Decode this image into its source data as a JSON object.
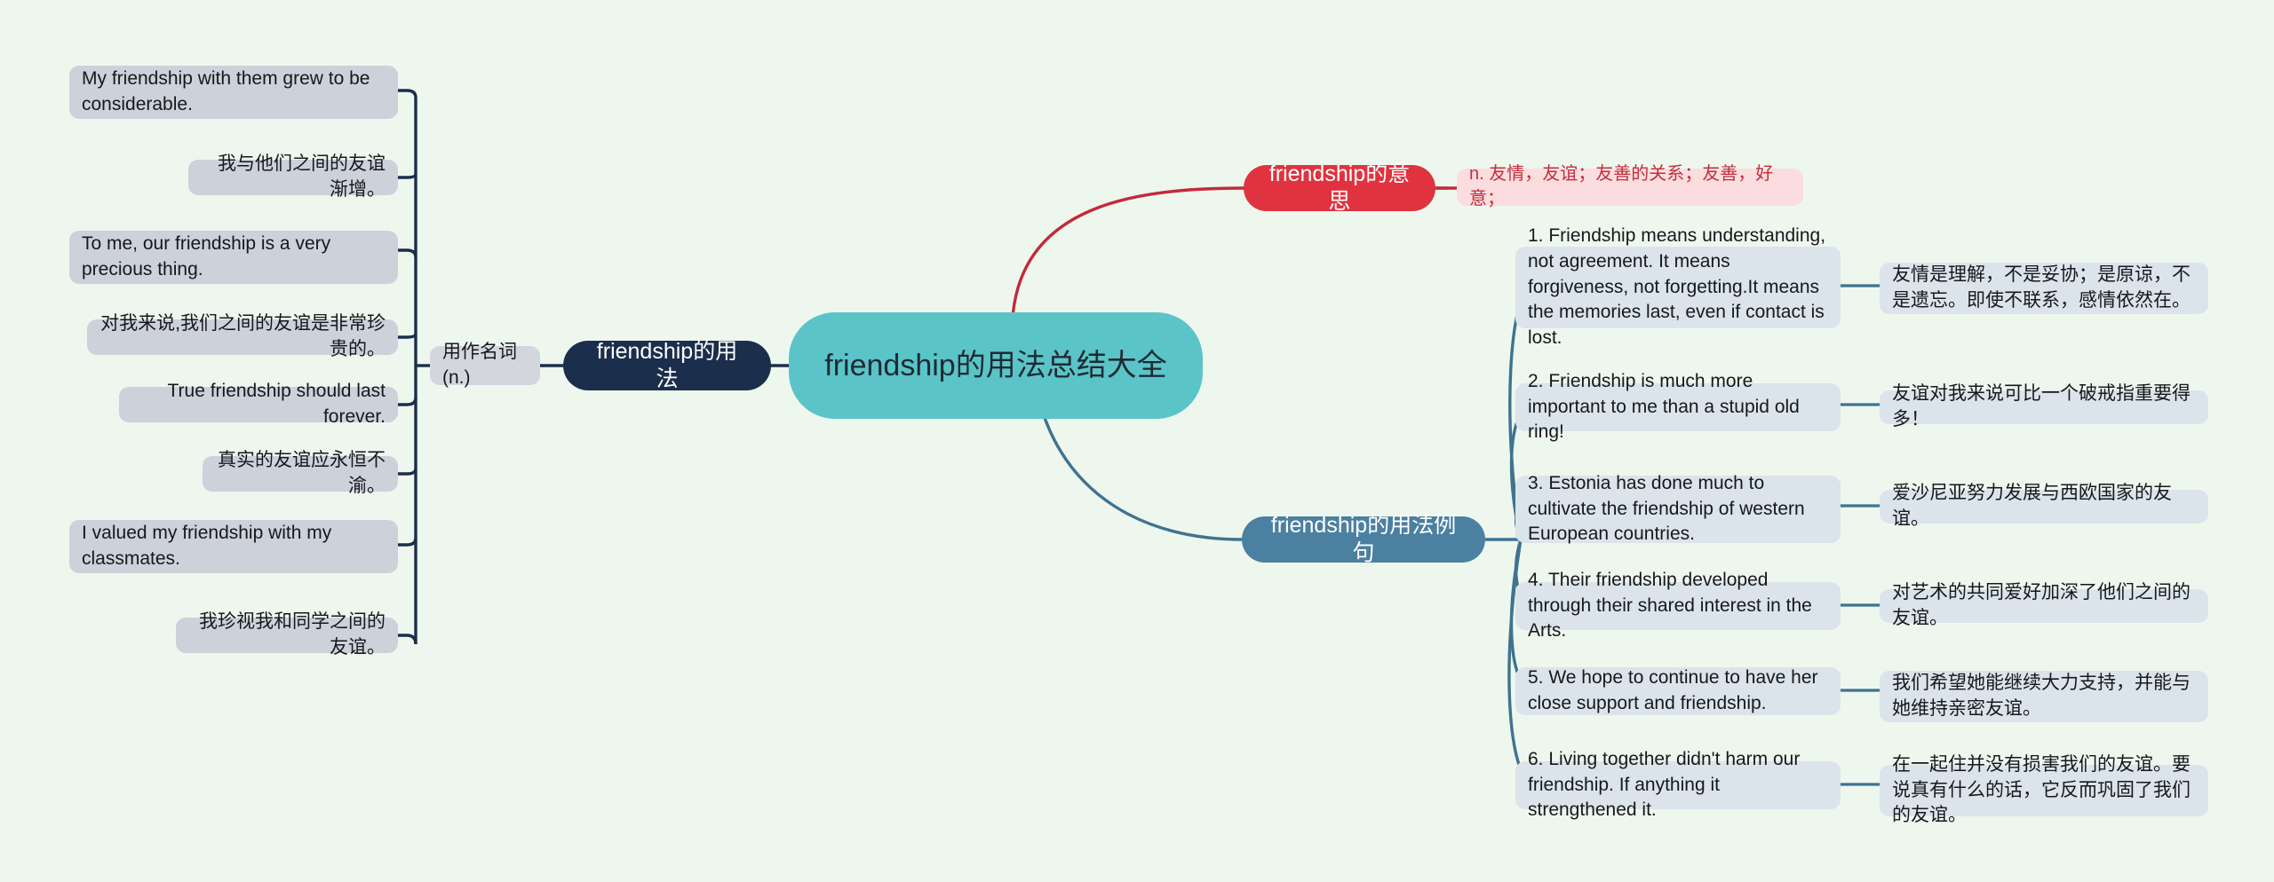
{
  "meta": {
    "background_color": "#eef7ee",
    "root_color": "#5ac4c8",
    "navy_color": "#1b2e4b",
    "red_color": "#e0333f",
    "blue_color": "#4b80a0",
    "grey_box_color": "#ccd1da",
    "blue_grey_box_color": "#dbe4ea",
    "pink_box_color": "#fbdcdf"
  },
  "root": {
    "label": "friendship的用法总结大全"
  },
  "branches": {
    "usage": {
      "label": "friendship的用法",
      "tag": "用作名词(n.)",
      "items": [
        {
          "en": "My friendship with them grew to be considerable.",
          "zh": "我与他们之间的友谊渐增。"
        },
        {
          "en": "To me, our friendship is a very precious thing.",
          "zh": "对我来说,我们之间的友谊是非常珍贵的。"
        },
        {
          "en": "True friendship should last forever.",
          "zh": "真实的友谊应永恒不渝。"
        },
        {
          "en": "I valued my friendship with my classmates.",
          "zh": "我珍视我和同学之间的友谊。"
        }
      ]
    },
    "meaning": {
      "label": "friendship的意思",
      "definition": "n. 友情，友谊；友善的关系；友善，好意；"
    },
    "examples": {
      "label": "friendship的用法例句",
      "items": [
        {
          "en": "1. Friendship means understanding, not agreement. It means forgiveness, not forgetting.It means the memories last, even if contact is lost.",
          "zh": "友情是理解，不是妥协；是原谅，不是遗忘。即使不联系，感情依然在。"
        },
        {
          "en": "2. Friendship is much more important to me than a stupid old ring!",
          "zh": "友谊对我来说可比一个破戒指重要得多！"
        },
        {
          "en": "3. Estonia has done much to cultivate the friendship of western European countries.",
          "zh": "爱沙尼亚努力发展与西欧国家的友谊。"
        },
        {
          "en": "4. Their friendship developed through their shared interest in the Arts.",
          "zh": "对艺术的共同爱好加深了他们之间的友谊。"
        },
        {
          "en": "5. We hope to continue to have her close support and friendship.",
          "zh": "我们希望她能继续大力支持，并能与她维持亲密友谊。"
        },
        {
          "en": "6. Living together didn't harm our friendship. If anything it strengthened it.",
          "zh": "在一起住并没有损害我们的友谊。要说真有什么的话，它反而巩固了我们的友谊。"
        }
      ]
    }
  }
}
